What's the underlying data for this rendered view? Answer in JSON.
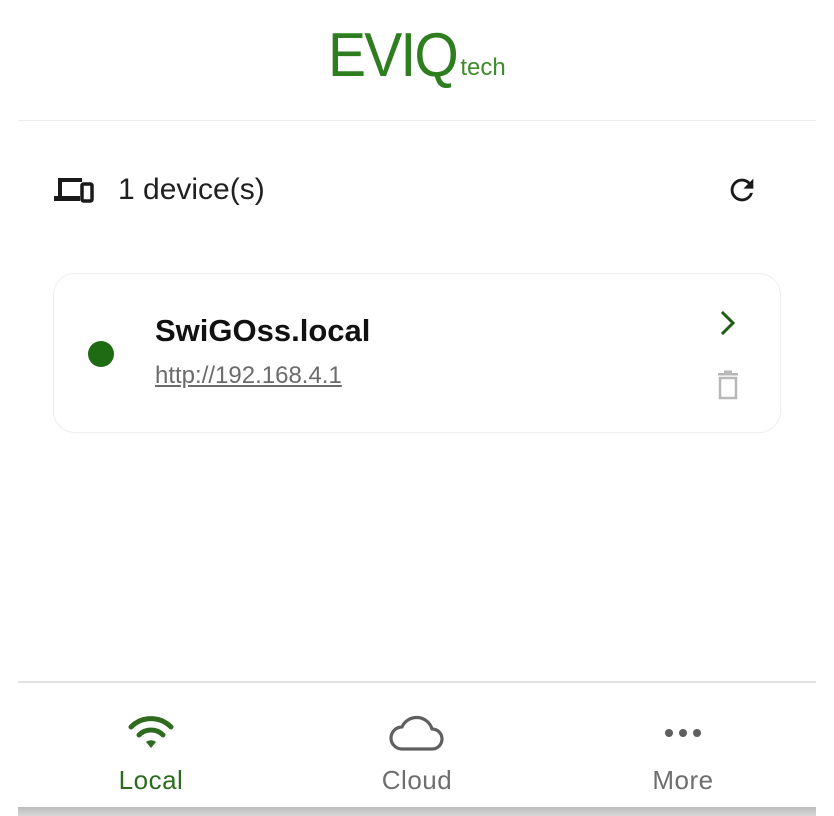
{
  "brand": {
    "logo_main": "EVIQ",
    "logo_sub": "tech",
    "color": "#2e7d1f"
  },
  "device_list": {
    "count_text": "1 device(s)",
    "count_icon": "devices-icon",
    "refresh_icon": "refresh-icon"
  },
  "devices": [
    {
      "name": "SwiGOss.local",
      "url": "http://192.168.4.1",
      "status": "online",
      "status_color": "#1e6b14",
      "open_icon": "chevron-right-icon",
      "delete_icon": "trash-icon"
    }
  ],
  "nav": {
    "active_color": "#2e6b1f",
    "inactive_color": "#6e6e6e",
    "items": [
      {
        "label": "Local",
        "icon": "wifi-icon",
        "active": true
      },
      {
        "label": "Cloud",
        "icon": "cloud-icon",
        "active": false
      },
      {
        "label": "More",
        "icon": "more-horizontal-icon",
        "active": false
      }
    ]
  }
}
